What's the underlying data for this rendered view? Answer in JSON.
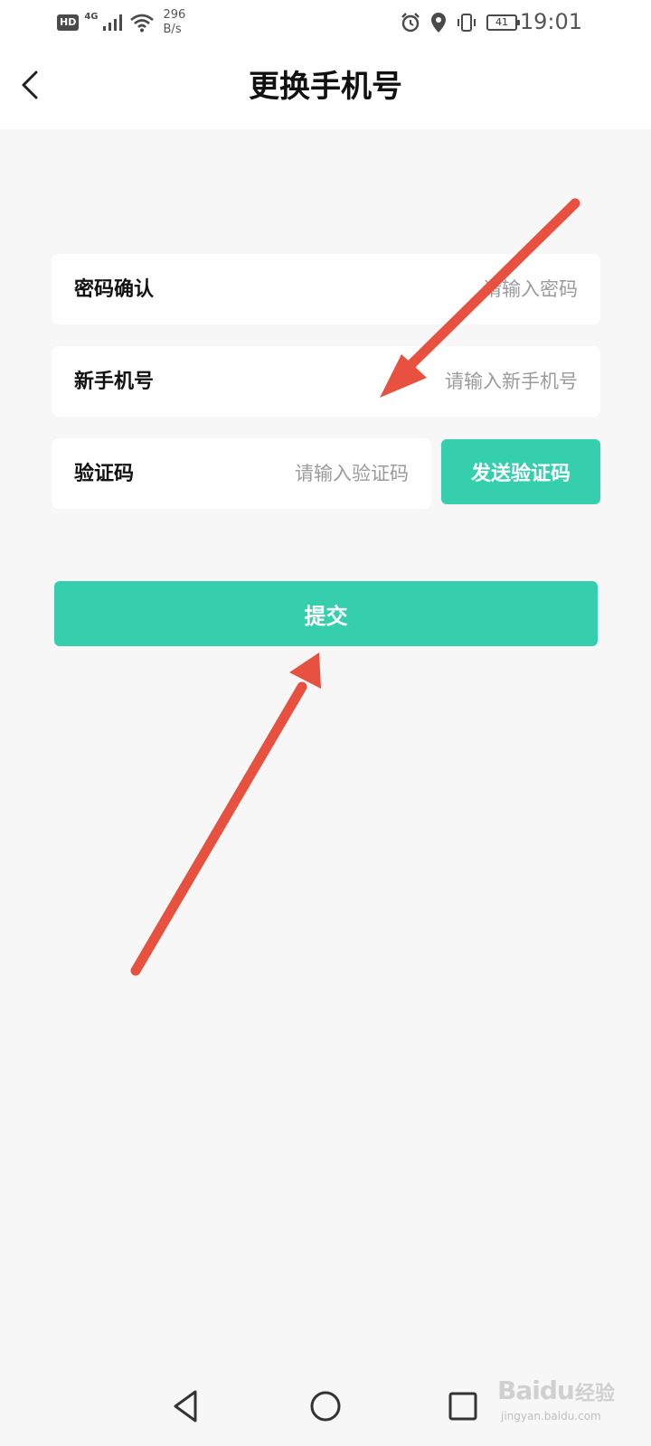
{
  "status_bar": {
    "hd": "HD",
    "network": "4G",
    "speed_value": "296",
    "speed_unit": "B/s",
    "battery": "41",
    "time": "19:01"
  },
  "header": {
    "title": "更换手机号"
  },
  "form": {
    "password": {
      "label": "密码确认",
      "placeholder": "请输入密码"
    },
    "new_phone": {
      "label": "新手机号",
      "placeholder": "请输入新手机号"
    },
    "code": {
      "label": "验证码",
      "placeholder": "请输入验证码",
      "send_label": "发送验证码"
    },
    "submit_label": "提交"
  },
  "colors": {
    "accent": "#36cfad",
    "annotation": "#e8513f",
    "background": "#f7f7f7"
  },
  "watermark": {
    "brand": "Baidu",
    "brand_cn": "经验",
    "url": "jingyan.baidu.com"
  }
}
